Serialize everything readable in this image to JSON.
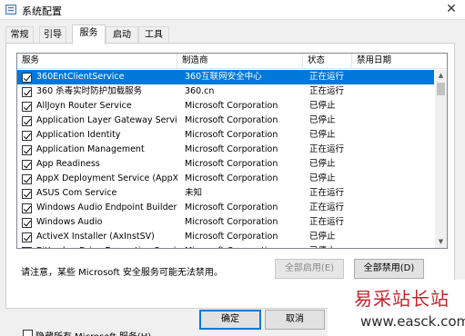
{
  "window": {
    "title": "系统配置"
  },
  "tabs": [
    {
      "label": "常规",
      "active": false
    },
    {
      "label": "引导",
      "active": false
    },
    {
      "label": "服务",
      "active": true
    },
    {
      "label": "启动",
      "active": false
    },
    {
      "label": "工具",
      "active": false
    }
  ],
  "columns": {
    "service": "服务",
    "maker": "制造商",
    "status": "状态",
    "disabled_date": "禁用日期"
  },
  "services": [
    {
      "name": "360EntClientService",
      "maker": "360互联网安全中心",
      "status": "正在运行",
      "checked": true,
      "selected": true
    },
    {
      "name": "360 杀毒实时防护加载服务",
      "maker": "360.cn",
      "status": "正在运行",
      "checked": true
    },
    {
      "name": "AllJoyn Router Service",
      "maker": "Microsoft Corporation",
      "status": "已停止",
      "checked": true
    },
    {
      "name": "Application Layer Gateway Service",
      "maker": "Microsoft Corporation",
      "status": "已停止",
      "checked": true
    },
    {
      "name": "Application Identity",
      "maker": "Microsoft Corporation",
      "status": "已停止",
      "checked": true
    },
    {
      "name": "Application Management",
      "maker": "Microsoft Corporation",
      "status": "正在运行",
      "checked": true
    },
    {
      "name": "App Readiness",
      "maker": "Microsoft Corporation",
      "status": "已停止",
      "checked": true
    },
    {
      "name": "AppX Deployment Service (AppX...",
      "maker": "Microsoft Corporation",
      "status": "已停止",
      "checked": true
    },
    {
      "name": "ASUS Com Service",
      "maker": "未知",
      "status": "正在运行",
      "checked": true
    },
    {
      "name": "Windows Audio Endpoint Builder",
      "maker": "Microsoft Corporation",
      "status": "正在运行",
      "checked": true
    },
    {
      "name": "Windows Audio",
      "maker": "Microsoft Corporation",
      "status": "正在运行",
      "checked": true
    },
    {
      "name": "ActiveX Installer (AxInstSV)",
      "maker": "Microsoft Corporation",
      "status": "已停止",
      "checked": true
    },
    {
      "name": "BitLocker Drive Encryption Service",
      "maker": "Microsoft Corporation",
      "status": "已停止",
      "checked": true
    }
  ],
  "note": "请注意，某些 Microsoft 安全服务可能无法禁用。",
  "buttons": {
    "enable_all": "全部启用(E)",
    "disable_all": "全部禁用(D)",
    "ok": "确定",
    "cancel": "取消"
  },
  "hide_ms": {
    "label": "隐藏所有 Microsoft 服务(H)",
    "checked": false
  },
  "watermark": {
    "text": "易采站长站",
    "url": "www.easck.com"
  },
  "colors": {
    "selection": "#0078d7",
    "watermark": "#c3232b"
  }
}
